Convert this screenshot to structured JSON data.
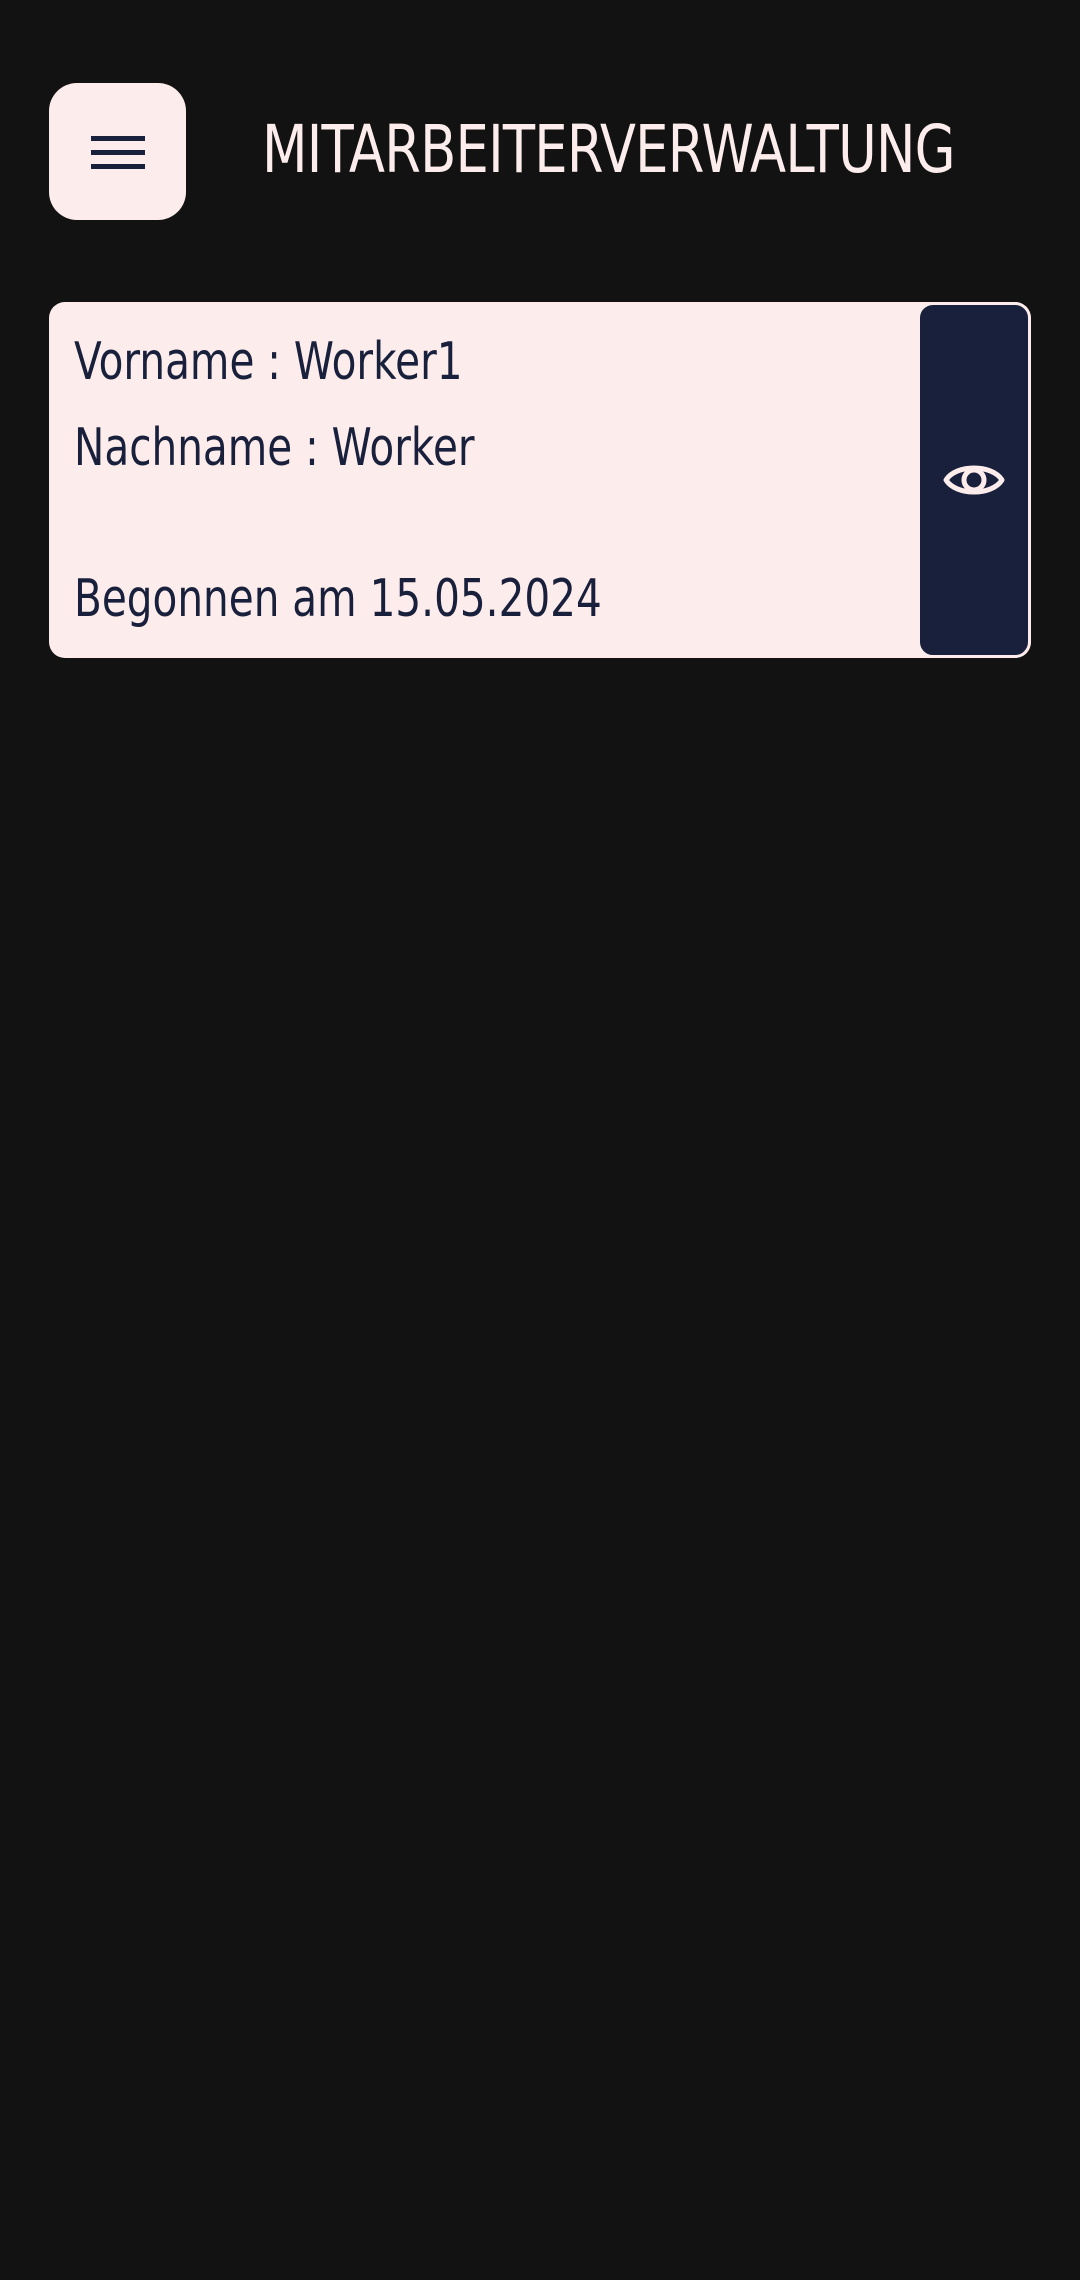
{
  "header": {
    "title": "MITARBEITERVERWALTUNG",
    "menu_icon": "hamburger-menu-icon"
  },
  "worker": {
    "first_name_line": "Vorname : Worker1",
    "last_name_line": "Nachname : Worker",
    "started_line": "Begonnen am 15.05.2024",
    "view_icon": "eye-icon"
  },
  "colors": {
    "background": "#121212",
    "card": "#FDECEC",
    "accent": "#19203C"
  }
}
